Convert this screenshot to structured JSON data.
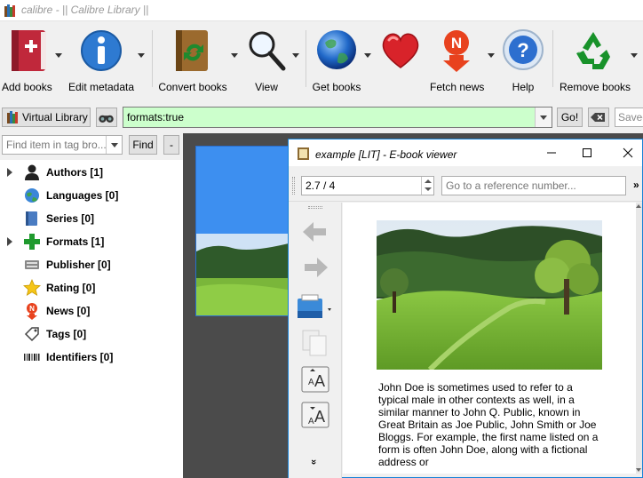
{
  "window": {
    "title": "calibre - || Calibre Library ||",
    "app_icon": "books-icon"
  },
  "toolbar": {
    "buttons": [
      {
        "label": "Add books",
        "icon": "add-book-icon"
      },
      {
        "label": "Edit metadata",
        "icon": "info-icon"
      },
      {
        "label": "Convert books",
        "icon": "convert-icon"
      },
      {
        "label": "View",
        "icon": "magnifier-icon"
      },
      {
        "label": "Get books",
        "icon": "globe-icon"
      },
      {
        "label": "",
        "icon": "heart-icon"
      },
      {
        "label": "Fetch news",
        "icon": "news-icon"
      },
      {
        "label": "Help",
        "icon": "help-icon"
      },
      {
        "label": "Remove books",
        "icon": "recycle-icon"
      }
    ]
  },
  "search": {
    "virtual_library_label": "Virtual Library",
    "query": "formats:true",
    "go_label": "Go!",
    "saved_placeholder": "Saved"
  },
  "tag_browser": {
    "find_placeholder": "Find item in tag bro...",
    "find_label": "Find",
    "collapse_label": "-",
    "items": [
      {
        "label": "Authors [1]",
        "icon": "person-icon",
        "expandable": true
      },
      {
        "label": "Languages [0]",
        "icon": "languages-icon",
        "expandable": false
      },
      {
        "label": "Series [0]",
        "icon": "series-icon",
        "expandable": false
      },
      {
        "label": "Formats [1]",
        "icon": "plus-icon",
        "expandable": true
      },
      {
        "label": "Publisher [0]",
        "icon": "publisher-icon",
        "expandable": false
      },
      {
        "label": "Rating [0]",
        "icon": "star-icon",
        "expandable": false
      },
      {
        "label": "News [0]",
        "icon": "news-icon",
        "expandable": false
      },
      {
        "label": "Tags [0]",
        "icon": "tag-icon",
        "expandable": false
      },
      {
        "label": "Identifiers [0]",
        "icon": "barcode-icon",
        "expandable": false
      }
    ]
  },
  "viewer": {
    "title": "example [LIT] - E-book viewer",
    "position": "2.7 / 4",
    "reference_placeholder": "Go to a reference number...",
    "more": "»",
    "paragraph": "John Doe is sometimes used to refer to a typical male in other contexts as well, in a similar manner to John Q. Public, known in Great Britain as Joe Public, John Smith or Joe Bloggs. For example, the first name listed on a form is often John Doe, along with a fictional address or",
    "sidebar_more": "»"
  }
}
